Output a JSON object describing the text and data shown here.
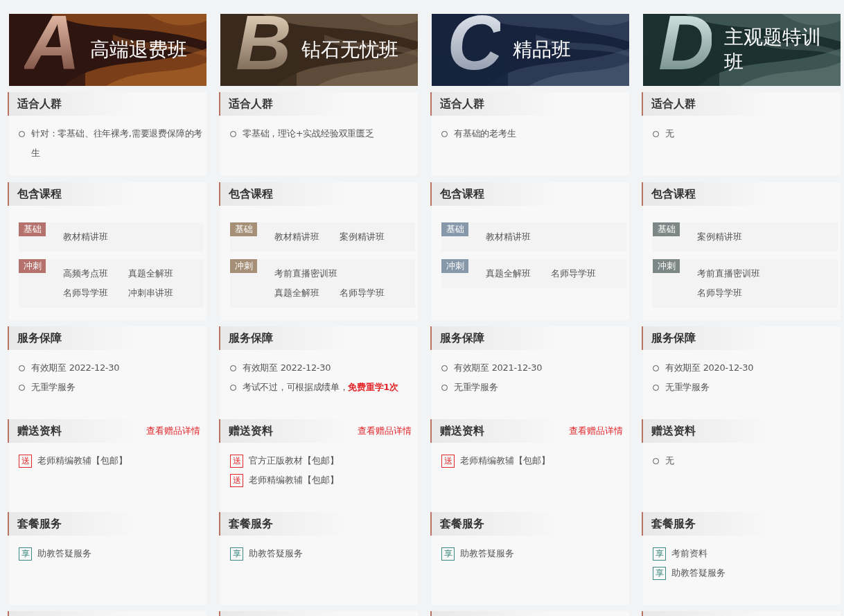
{
  "plans": [
    {
      "letter": "A",
      "title": "高端退费班",
      "color": "#b5716b",
      "sections": [
        {
          "kind": "audience",
          "title": "适合人群",
          "items": [
            "针对：零基础、往年裸考,需要退费保障的考生"
          ]
        },
        {
          "kind": "courses",
          "title": "包含课程",
          "groups": [
            {
              "tag": "基础",
              "lines": [
                [
                  "教材精讲班"
                ]
              ]
            },
            {
              "tag": "冲刺",
              "lines": [
                [
                  "高频考点班",
                  "真题全解班"
                ],
                [
                  "名师导学班",
                  "冲刺串讲班"
                ]
              ]
            }
          ]
        },
        {
          "kind": "service",
          "title": "服务保障",
          "items": [
            "有效期至 2022-12-30",
            "无重学服务"
          ]
        },
        {
          "kind": "gifts",
          "title": "赠送资料",
          "link": "查看赠品详情",
          "items": [
            {
              "kind": "gift",
              "badge": "送",
              "text": "老师精编教辅【包邮】"
            }
          ]
        },
        {
          "kind": "package",
          "title": "套餐服务",
          "items": [
            {
              "kind": "perk",
              "badge": "享",
              "text": "助教答疑服务"
            }
          ]
        }
      ]
    },
    {
      "letter": "B",
      "title": "钻石无忧班",
      "color": "#a58f77",
      "sections": [
        {
          "kind": "audience",
          "title": "适合人群",
          "items": [
            "零基础，理论+实战经验双重匮乏"
          ]
        },
        {
          "kind": "courses",
          "title": "包含课程",
          "groups": [
            {
              "tag": "基础",
              "lines": [
                [
                  "教材精讲班",
                  "案例精讲班"
                ]
              ]
            },
            {
              "tag": "冲刺",
              "lines": [
                [
                  "考前直播密训班"
                ],
                [
                  "真题全解班",
                  "名师导学班"
                ]
              ]
            }
          ]
        },
        {
          "kind": "service",
          "title": "服务保障",
          "items": [
            "有效期至 2022-12-30",
            "考试不过，可根据成绩单，**免费重学1次**"
          ]
        },
        {
          "kind": "gifts",
          "title": "赠送资料",
          "link": "查看赠品详情",
          "items": [
            {
              "kind": "gift",
              "badge": "送",
              "text": "官方正版教材【包邮】"
            },
            {
              "kind": "gift",
              "badge": "送",
              "text": "老师精编教辅【包邮】"
            }
          ]
        },
        {
          "kind": "package",
          "title": "套餐服务",
          "items": [
            {
              "kind": "perk",
              "badge": "享",
              "text": "助教答疑服务"
            }
          ]
        }
      ]
    },
    {
      "letter": "C",
      "title": "精品班",
      "color": "#8798ab",
      "sections": [
        {
          "kind": "audience",
          "title": "适合人群",
          "items": [
            "有基础的老考生"
          ]
        },
        {
          "kind": "courses",
          "title": "包含课程",
          "groups": [
            {
              "tag": "基础",
              "lines": [
                [
                  "教材精讲班"
                ]
              ]
            },
            {
              "tag": "冲刺",
              "lines": [
                [
                  "真题全解班",
                  "名师导学班"
                ]
              ]
            }
          ]
        },
        {
          "kind": "service",
          "title": "服务保障",
          "items": [
            "有效期至 2021-12-30",
            "无重学服务"
          ]
        },
        {
          "kind": "gifts",
          "title": "赠送资料",
          "link": "查看赠品详情",
          "items": [
            {
              "kind": "gift",
              "badge": "送",
              "text": "老师精编教辅【包邮】"
            }
          ]
        },
        {
          "kind": "package",
          "title": "套餐服务",
          "items": [
            {
              "kind": "perk",
              "badge": "享",
              "text": "助教答疑服务"
            }
          ]
        }
      ]
    },
    {
      "letter": "D",
      "title": "主观题特训班",
      "color": "#7d8886",
      "sections": [
        {
          "kind": "audience",
          "title": "适合人群",
          "items": [
            "无"
          ]
        },
        {
          "kind": "courses",
          "title": "包含课程",
          "groups": [
            {
              "tag": "基础",
              "lines": [
                [
                  "案例精讲班"
                ]
              ]
            },
            {
              "tag": "冲刺",
              "lines": [
                [
                  "考前直播密训班"
                ],
                [
                  "名师导学班"
                ]
              ]
            }
          ]
        },
        {
          "kind": "service",
          "title": "服务保障",
          "items": [
            "有效期至 2020-12-30",
            "无重学服务"
          ]
        },
        {
          "kind": "gifts",
          "title": "赠送资料",
          "items": [
            {
              "kind": "plain",
              "text": "无"
            }
          ]
        },
        {
          "kind": "package",
          "title": "套餐服务",
          "items": [
            {
              "kind": "perk",
              "badge": "享",
              "text": "考前资料"
            },
            {
              "kind": "perk",
              "badge": "享",
              "text": "助教答疑服务"
            }
          ]
        }
      ]
    }
  ]
}
